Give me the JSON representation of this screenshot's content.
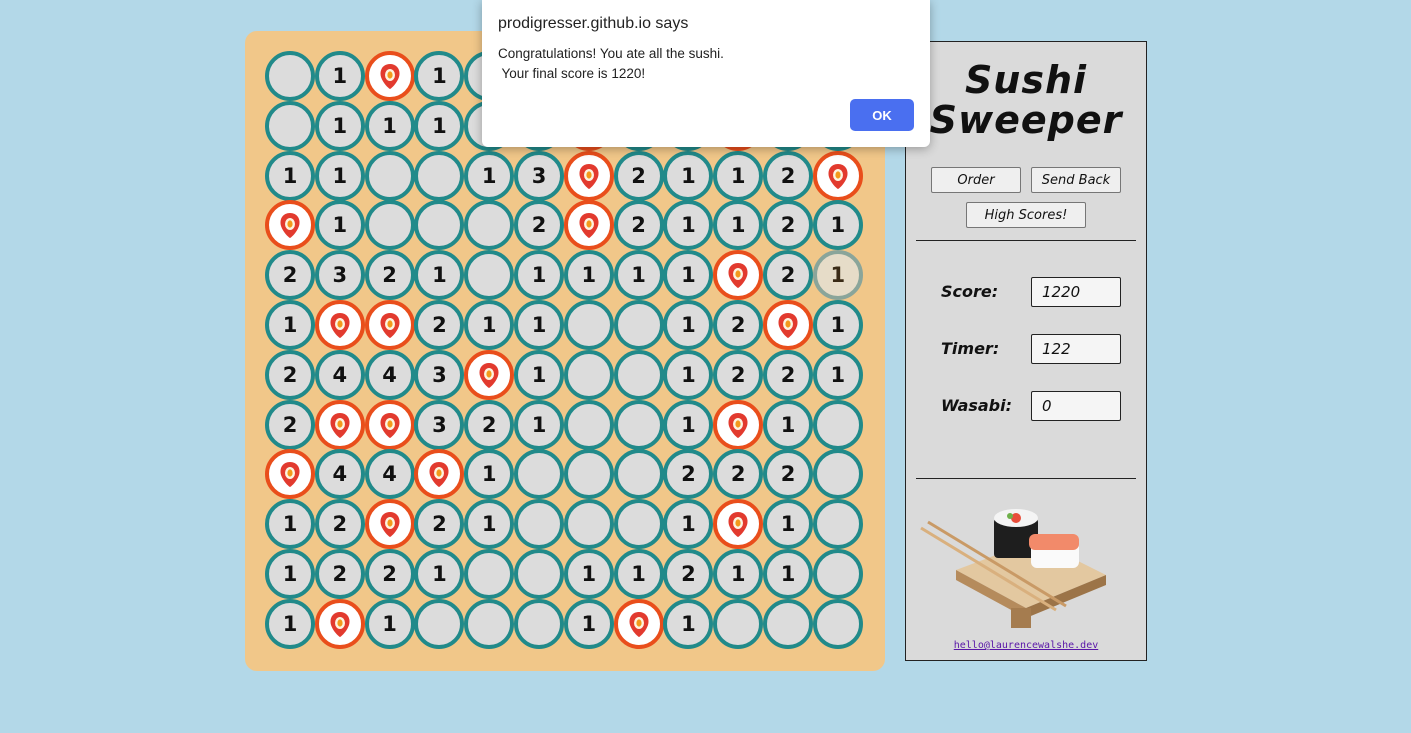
{
  "board": {
    "grid": [
      [
        "",
        "1",
        "S",
        "1",
        "",
        "",
        "",
        "",
        "",
        "",
        "",
        ""
      ],
      [
        "",
        "1",
        "1",
        "1",
        "",
        "",
        "S",
        "",
        "",
        "S",
        "",
        ""
      ],
      [
        "1",
        "1",
        "",
        "",
        "1",
        "3",
        "S",
        "2",
        "1",
        "1",
        "2",
        "S"
      ],
      [
        "S",
        "1",
        "",
        "",
        "",
        "2",
        "S",
        "2",
        "1",
        "1",
        "2",
        "1"
      ],
      [
        "2",
        "3",
        "2",
        "1",
        "",
        "1",
        "1",
        "1",
        "1",
        "S",
        "2",
        "1"
      ],
      [
        "1",
        "S",
        "S",
        "2",
        "1",
        "1",
        "",
        "",
        "1",
        "2",
        "S",
        "1"
      ],
      [
        "2",
        "4",
        "4",
        "3",
        "S",
        "1",
        "",
        "",
        "1",
        "2",
        "2",
        "1"
      ],
      [
        "2",
        "S",
        "S",
        "3",
        "2",
        "1",
        "",
        "",
        "1",
        "S",
        "1",
        ""
      ],
      [
        "S",
        "4",
        "4",
        "S",
        "1",
        "",
        "",
        "",
        "2",
        "2",
        "2",
        ""
      ],
      [
        "1",
        "2",
        "S",
        "2",
        "1",
        "",
        "",
        "",
        "1",
        "S",
        "1",
        ""
      ],
      [
        "1",
        "2",
        "2",
        "1",
        "",
        "",
        "1",
        "1",
        "2",
        "1",
        "1",
        ""
      ],
      [
        "1",
        "S",
        "1",
        "",
        "",
        "",
        "1",
        "S",
        "1",
        "",
        "",
        ""
      ]
    ],
    "hover_cell": "4-11"
  },
  "panel": {
    "title_line1": "Sushi",
    "title_line2": "Sweeper",
    "order_label": "Order",
    "send_back_label": "Send Back",
    "high_scores_label": "High Scores!",
    "score_label": "Score:",
    "score_value": "1220",
    "timer_label": "Timer:",
    "timer_value": "122",
    "wasabi_label": "Wasabi:",
    "wasabi_value": "0",
    "email": "hello@laurencewalshe.dev"
  },
  "dialog": {
    "title": "prodigresser.github.io says",
    "message_line1": "Congratulations! You ate all the sushi.",
    "message_line2": " Your final score is 1220!",
    "ok_label": "OK"
  },
  "colors": {
    "background": "#b3d8e8",
    "board": "#f1c789",
    "cell_border": "#218a8a",
    "sushi_border": "#e94e1b",
    "ok_button": "#4a6ff0"
  },
  "icons": {
    "sushi_marker": "sushi-marker-icon"
  }
}
